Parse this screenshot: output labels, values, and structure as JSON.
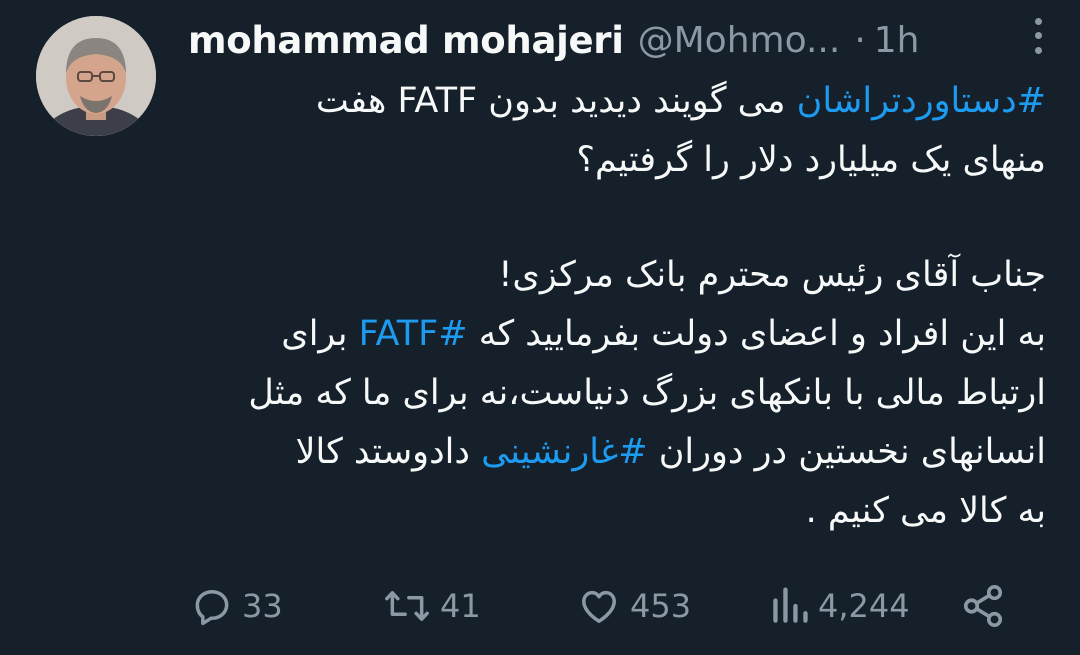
{
  "author": {
    "name": "mohammad mohajeri",
    "handle": "@Mohmo...",
    "separator": "·",
    "time": "1h"
  },
  "tweet": {
    "line1_hashtag": "#دستاوردتراشان",
    "line1_text": " می گویند دیدید بدون FATF هفت",
    "line2": "منهای یک میلیارد دلار را گرفتیم؟",
    "line3": "جناب آقای رئیس محترم بانک مرکزی!",
    "line4_before": "به این افراد و اعضای دولت بفرمایید که ",
    "line4_hashtag": "#FATF",
    "line4_after": " برای",
    "line5": "ارتباط مالی با بانکهای بزرگ دنیاست،نه برای ما که مثل",
    "line6_before": "انسانهای نخستین در دوران ",
    "line6_hashtag": "#غارنشینی",
    "line6_after": " دادوستد کالا",
    "line7": "به کالا می کنیم ."
  },
  "actions": {
    "replies": "33",
    "retweets": "41",
    "likes": "453",
    "views": "4,244"
  },
  "icons": [
    "reply-icon",
    "retweet-icon",
    "like-icon",
    "views-icon",
    "share-icon",
    "more-icon"
  ],
  "colors": {
    "background": "#15202b",
    "text": "#f7f9f9",
    "muted": "#8b98a5",
    "hashtag": "#1d9bf0"
  }
}
